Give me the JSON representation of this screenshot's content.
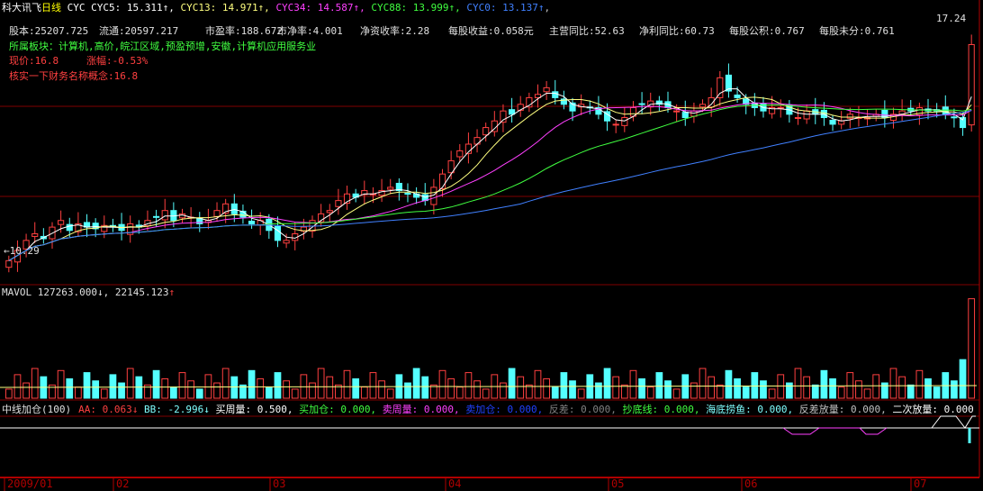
{
  "header": {
    "title": "科大讯飞",
    "period": "日线",
    "indicator": "CYC",
    "ma": [
      {
        "label": "CYC5: 15.311",
        "color": "#ffffff"
      },
      {
        "label": "CYC13: 14.971",
        "color": "#ffff80"
      },
      {
        "label": "CYC34: 14.587",
        "color": "#ff40ff"
      },
      {
        "label": "CYC88: 13.999",
        "color": "#40ff40"
      },
      {
        "label": "CYC0: 13.137",
        "color": "#4080ff"
      }
    ],
    "up_arrow": "↑",
    "trailing": ","
  },
  "info": {
    "row1": [
      "股本:25207.725",
      "流通:20597.217",
      "市盈率:188.672",
      "市净率:4.001",
      "净资收率:2.28",
      "每股收益:0.058元",
      "主营同比:52.63",
      "净利同比:60.73",
      "每股公积:0.767",
      "每股未分:0.761"
    ],
    "sector": "所属板块：计算机,高价,皖江区域,预盈预增,安徽,计算机应用服务业",
    "price": "现价:16.8",
    "change": "涨幅:-0.53%",
    "concept": "核实一下财务名称概念:16.8"
  },
  "price_labels": {
    "high": "17.24",
    "low": "10.29"
  },
  "volume_header": {
    "name": "MAVOL",
    "v1": "127263.000",
    "down": "↓",
    "v2": "22145.123",
    "up": "↑"
  },
  "indicator_header": {
    "name": "中线加仓(100)",
    "items": [
      {
        "text": "AA: 0.063↓",
        "color": "#ff4040"
      },
      {
        "text": "BB: -2.996↓",
        "color": "#80ffff"
      },
      {
        "text": "买周量: 0.500,",
        "color": "#ffffff"
      },
      {
        "text": "买加仓: 0.000,",
        "color": "#40ff40"
      },
      {
        "text": "卖周量: 0.000,",
        "color": "#ff40ff"
      },
      {
        "text": "卖加仓: 0.000,",
        "color": "#2040ff"
      },
      {
        "text": "反差: 0.000,",
        "color": "#808080"
      },
      {
        "text": "抄底线: 0.000,",
        "color": "#40ff40"
      },
      {
        "text": "海底捞鱼: 0.000,",
        "color": "#80ffff"
      },
      {
        "text": "反差放量: 0.000,",
        "color": "#c0c0c0"
      },
      {
        "text": "二次放量: 0.000",
        "color": "#ffffff"
      }
    ]
  },
  "time_axis": [
    {
      "label": "2009/01",
      "pos": 0.005
    },
    {
      "label": "02",
      "pos": 0.116
    },
    {
      "label": "03",
      "pos": 0.276
    },
    {
      "label": "04",
      "pos": 0.455
    },
    {
      "label": "05",
      "pos": 0.621
    },
    {
      "label": "06",
      "pos": 0.757
    },
    {
      "label": "07",
      "pos": 0.93
    }
  ],
  "colors": {
    "up": "#ff4040",
    "down": "#54ffff",
    "grid": "#800000",
    "axis": "#b00000"
  },
  "chart_data": {
    "type": "candlestick",
    "title": "科大讯飞 日线",
    "ylim": [
      10.0,
      17.6
    ],
    "close": [
      10.29,
      10.6,
      10.9,
      11.1,
      10.95,
      11.3,
      11.5,
      11.2,
      11.4,
      11.3,
      11.25,
      11.35,
      11.3,
      11.2,
      11.4,
      11.3,
      11.5,
      11.6,
      11.8,
      11.5,
      11.7,
      11.6,
      11.4,
      11.5,
      11.8,
      12.0,
      11.7,
      11.6,
      11.4,
      11.5,
      11.2,
      10.9,
      10.9,
      11.1,
      11.3,
      11.5,
      11.7,
      11.8,
      12.1,
      12.3,
      12.2,
      12.4,
      12.3,
      12.4,
      12.5,
      12.4,
      12.3,
      12.2,
      12.1,
      12.5,
      12.9,
      13.3,
      13.6,
      13.8,
      14.0,
      14.3,
      14.5,
      14.8,
      14.7,
      15.0,
      15.2,
      15.3,
      15.5,
      15.2,
      15.0,
      14.8,
      15.0,
      14.9,
      14.7,
      14.5,
      14.4,
      14.6,
      14.9,
      15.0,
      15.1,
      15.0,
      14.9,
      14.8,
      14.6,
      14.8,
      15.0,
      15.2,
      15.8,
      15.4,
      15.2,
      15.0,
      14.9,
      14.8,
      14.9,
      14.9,
      14.7,
      14.6,
      14.8,
      14.7,
      14.6,
      14.4,
      14.5,
      14.7,
      14.6,
      14.6,
      14.7,
      14.6,
      14.7,
      14.8,
      14.8,
      14.9,
      14.8,
      14.8,
      14.7,
      14.6,
      14.3,
      16.8
    ],
    "volume_scale": [
      0,
      127263
    ]
  }
}
